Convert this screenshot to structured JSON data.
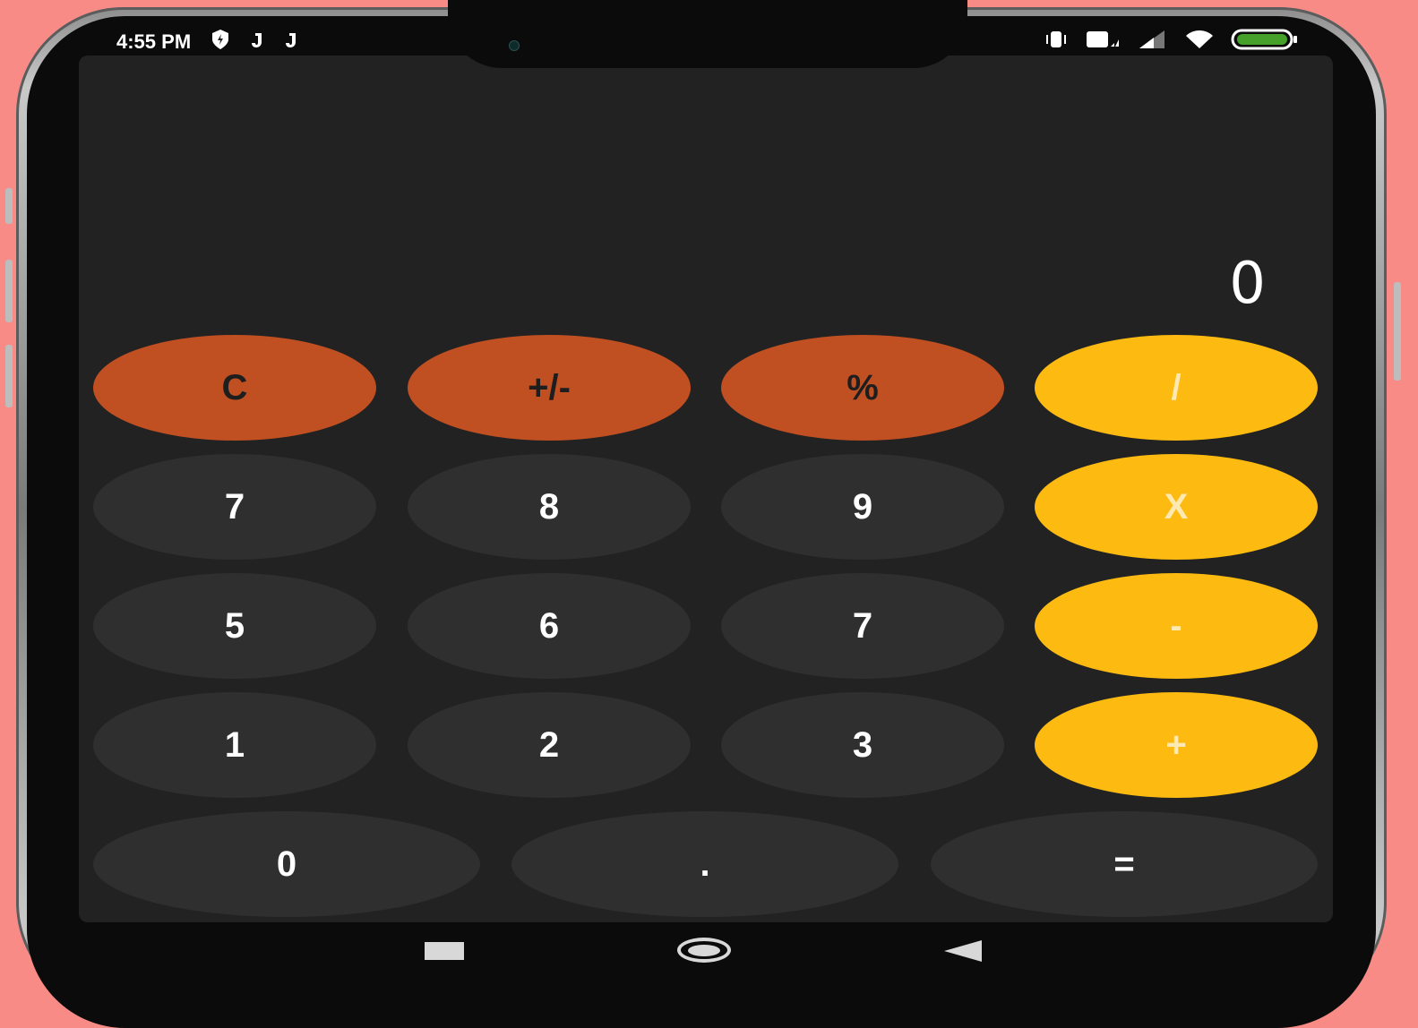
{
  "status_bar": {
    "time": "4:55 PM",
    "left_icons": [
      "shield-icon",
      "j-notification-icon",
      "j-notification-icon"
    ],
    "right_icons": [
      "vibrate-icon",
      "lte-icon",
      "signal-icon",
      "wifi-icon",
      "battery-icon"
    ]
  },
  "display": {
    "value": "0"
  },
  "keypad": {
    "rows": [
      [
        {
          "label": "C",
          "type": "func"
        },
        {
          "label": "+/-",
          "type": "func"
        },
        {
          "label": "%",
          "type": "func"
        },
        {
          "label": "/",
          "type": "op"
        }
      ],
      [
        {
          "label": "7",
          "type": "num"
        },
        {
          "label": "8",
          "type": "num"
        },
        {
          "label": "9",
          "type": "num"
        },
        {
          "label": "X",
          "type": "op"
        }
      ],
      [
        {
          "label": "5",
          "type": "num"
        },
        {
          "label": "6",
          "type": "num"
        },
        {
          "label": "7",
          "type": "num"
        },
        {
          "label": "-",
          "type": "op"
        }
      ],
      [
        {
          "label": "1",
          "type": "num"
        },
        {
          "label": "2",
          "type": "num"
        },
        {
          "label": "3",
          "type": "num"
        },
        {
          "label": "+",
          "type": "op"
        }
      ],
      [
        {
          "label": "0",
          "type": "num"
        },
        {
          "label": ".",
          "type": "num"
        },
        {
          "label": "=",
          "type": "num"
        }
      ]
    ]
  },
  "colors": {
    "function_key": "#c04f22",
    "operator_key": "#fdbb12",
    "number_key": "#2f2f2f",
    "screen_background": "#222222",
    "page_background": "#f98b86"
  },
  "nav_bar": {
    "icons": [
      "recents-icon",
      "home-icon",
      "back-icon"
    ]
  }
}
